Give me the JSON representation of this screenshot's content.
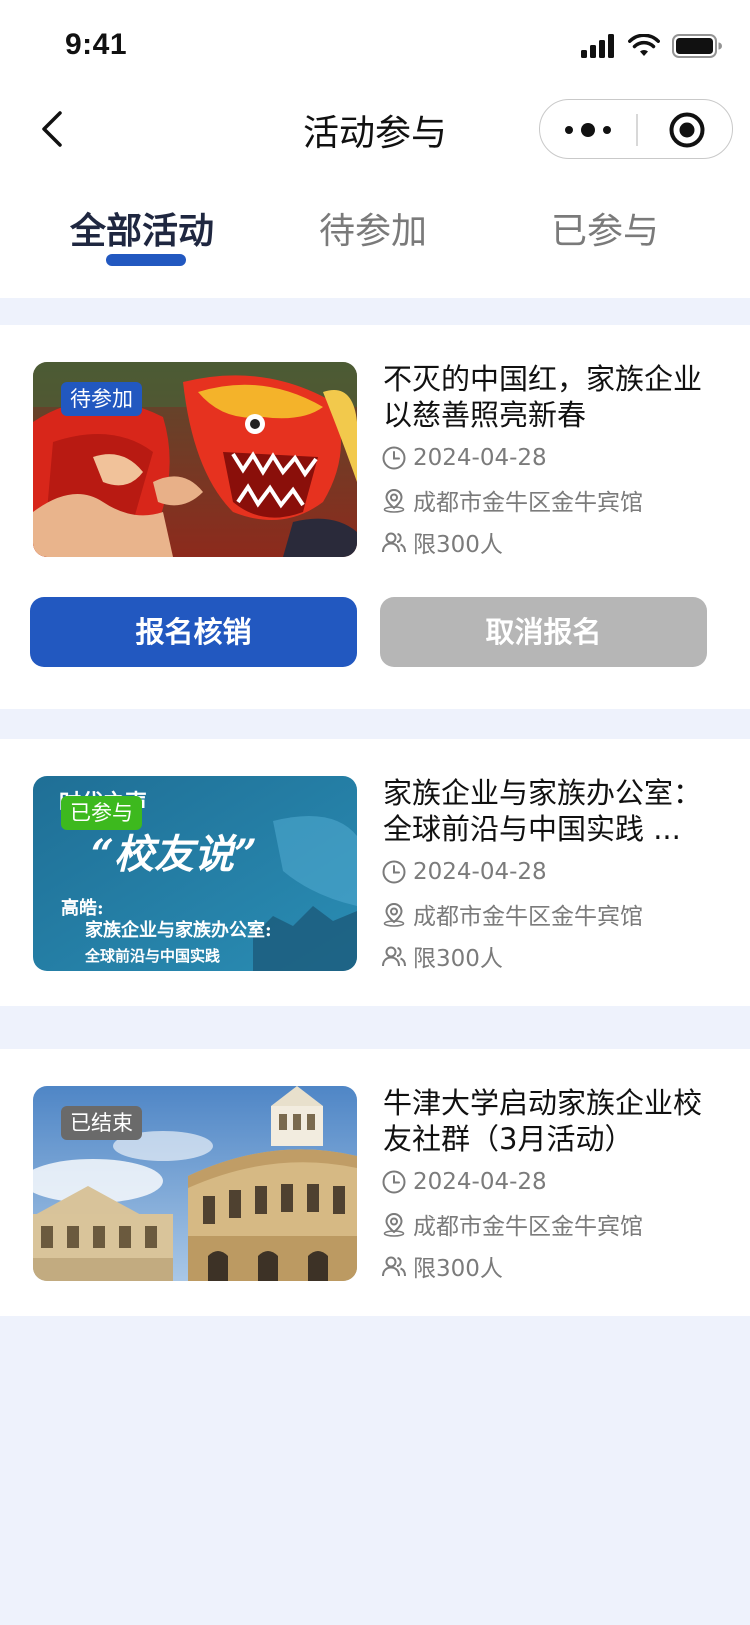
{
  "status_bar": {
    "time": "9:41"
  },
  "nav": {
    "title": "活动参与"
  },
  "tabs": [
    {
      "label": "全部活动",
      "active": true
    },
    {
      "label": "待参加",
      "active": false
    },
    {
      "label": "已参与",
      "active": false
    }
  ],
  "events": [
    {
      "badge": "待参加",
      "badge_color": "#2258c0",
      "title": "不灭的中国红，家族企业以慈善照亮新春",
      "date": "2024-04-28",
      "location": "成都市金牛区金牛宾馆",
      "limit": "限300人",
      "image": "dragon-dance-photo"
    },
    {
      "badge": "已参与",
      "badge_color": "#3db91e",
      "title": "家族企业与家族办公室：全球前沿与中国实践 ...",
      "date": "2024-04-28",
      "location": "成都市金牛区金牛宾馆",
      "limit": "限300人",
      "image": "alumni-talk-poster",
      "image_text": {
        "top": "时代之声",
        "quote": "“校友说”",
        "speaker": "高皓:",
        "line1": "家族企业与家族办公室:",
        "line2": "全球前沿与中国实践"
      }
    },
    {
      "badge": "已结束",
      "badge_color": "#6a6a6a",
      "title": "牛津大学启动家族企业校友社群（3月活动）",
      "date": "2024-04-28",
      "location": "成都市金牛区金牛宾馆",
      "limit": "限300人",
      "image": "oxford-building-photo"
    }
  ],
  "actions": {
    "checkin_label": "报名核销",
    "checkin_color": "#2258c0",
    "cancel_label": "取消报名",
    "cancel_color": "#b6b6b6"
  }
}
